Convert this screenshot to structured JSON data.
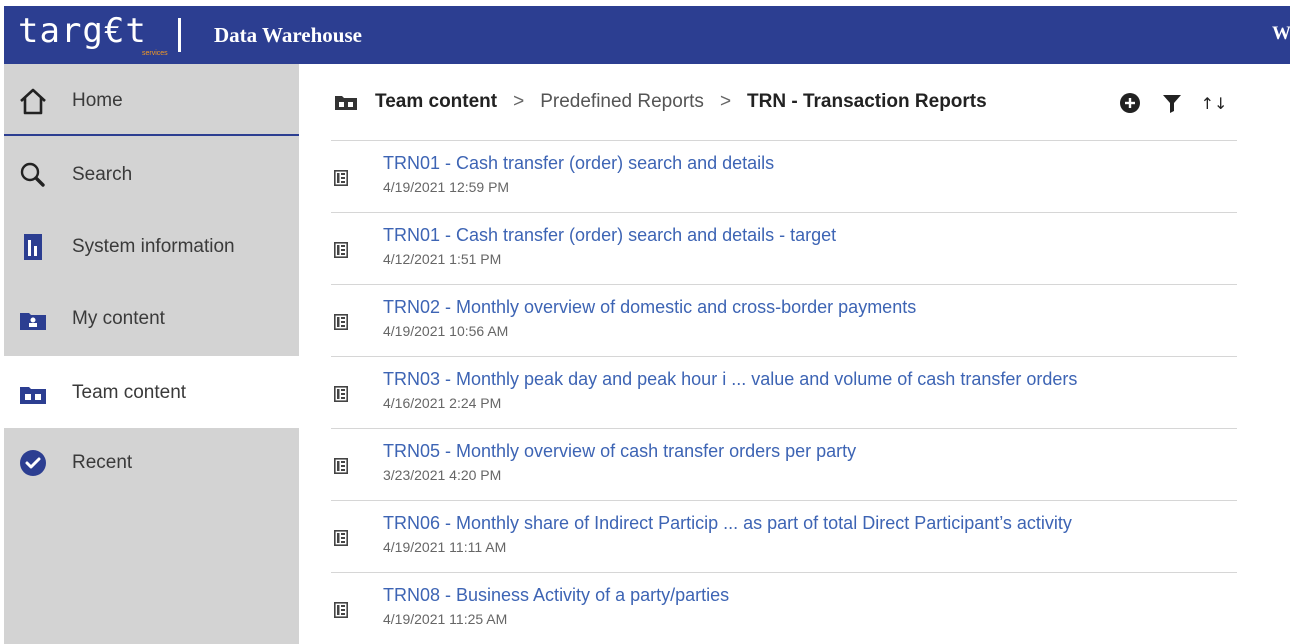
{
  "header": {
    "logo_text": "targ€t",
    "logo_sub": "services",
    "app_title": "Data Warehouse",
    "welcome_text": "We"
  },
  "sidebar": {
    "items": [
      {
        "label": "Home",
        "icon": "home-icon"
      },
      {
        "label": "Search",
        "icon": "search-icon"
      },
      {
        "label": "System information",
        "icon": "system-info-icon"
      },
      {
        "label": "My content",
        "icon": "my-folder-icon"
      },
      {
        "label": "Team content",
        "icon": "team-folder-icon",
        "active": true
      },
      {
        "label": "Recent",
        "icon": "recent-icon"
      }
    ]
  },
  "breadcrumb": {
    "root": "Team content",
    "middle": "Predefined Reports",
    "current": "TRN - Transaction Reports",
    "separator": ">"
  },
  "toolbar": {
    "add_icon": "add-circle-icon",
    "filter_icon": "filter-icon",
    "sort_icon": "sort-icon",
    "sort_glyph": "↑↓"
  },
  "reports": [
    {
      "title": "TRN01 - Cash transfer (order) search and details",
      "date": "4/19/2021 12:59 PM"
    },
    {
      "title": "TRN01 - Cash transfer (order) search and details - target",
      "date": "4/12/2021 1:51 PM"
    },
    {
      "title": "TRN02 - Monthly overview of domestic and cross-border payments",
      "date": "4/19/2021 10:56 AM"
    },
    {
      "title": "TRN03 - Monthly peak day and peak hour i ... value and volume of cash transfer orders",
      "date": "4/16/2021 2:24 PM"
    },
    {
      "title": "TRN05 - Monthly overview of cash transfer orders per party",
      "date": "3/23/2021 4:20 PM"
    },
    {
      "title": "TRN06 - Monthly share of Indirect Particip ... as part of total Direct Participant’s activity",
      "date": "4/19/2021 11:11 AM"
    },
    {
      "title": "TRN08 - Business Activity of a party/parties",
      "date": "4/19/2021 11:25 AM"
    }
  ],
  "colors": {
    "header_bg": "#2c3e91",
    "accent": "#2c3e91",
    "link": "#3d64b4",
    "logo_sub": "#f59a23",
    "sidebar_bg": "#d3d3d3"
  }
}
